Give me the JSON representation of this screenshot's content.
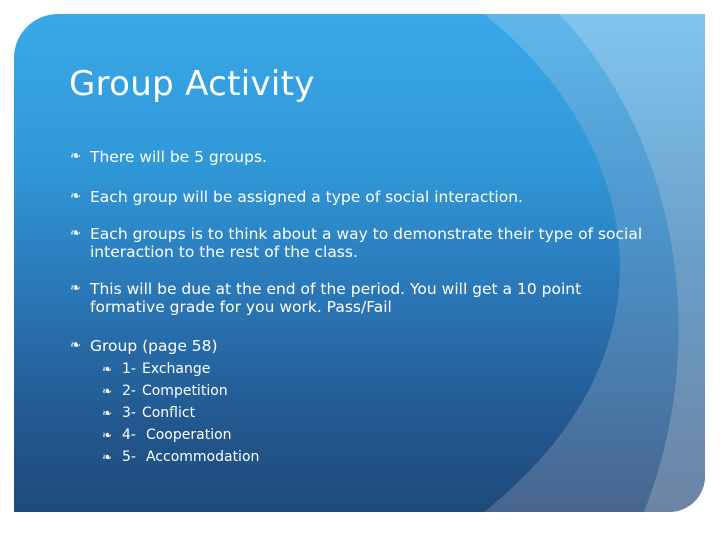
{
  "slide": {
    "title": "Group Activity",
    "bullet_icon": "curly-loop-bullet-icon",
    "bullet_glyph": "❧",
    "bullets": [
      {
        "text": "There will be 5 groups."
      },
      {
        "text": "Each group will be assigned a type of social interaction."
      },
      {
        "text": "Each groups is to think about a way to demonstrate their type of social interaction to the rest of the class."
      },
      {
        "text": "This will be due at the end of the period. You will get a 10 point formative grade for you work. Pass/Fail"
      },
      {
        "text": "Group (page 58)"
      }
    ],
    "groups": [
      {
        "number": "1-",
        "name": "Exchange"
      },
      {
        "number": "2-",
        "name": "Competition"
      },
      {
        "number": "3-",
        "name": "Conflict"
      },
      {
        "number": "4-",
        "name": "Cooperation"
      },
      {
        "number": "5-",
        "name": "Accommodation"
      }
    ],
    "colors": {
      "background_top": "#3aa8e8",
      "background_bottom": "#1e4a7a",
      "swoosh_light": "#7fc4ee",
      "text": "#ffffff"
    }
  }
}
